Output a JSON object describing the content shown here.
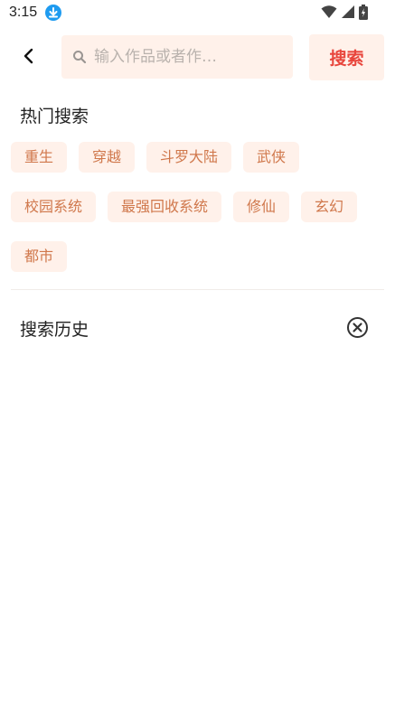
{
  "status_bar": {
    "time": "3:15",
    "icons": [
      "download-icon",
      "wifi-icon",
      "signal-icon",
      "battery-charging-icon"
    ]
  },
  "search": {
    "placeholder": "输入作品或者作…",
    "value": "",
    "button_label": "搜索"
  },
  "hot_search": {
    "title": "热门搜索",
    "tags": [
      "重生",
      "穿越",
      "斗罗大陆",
      "武侠",
      "校园系统",
      "最强回收系统",
      "修仙",
      "玄幻",
      "都市"
    ]
  },
  "history": {
    "title": "搜索历史",
    "items": []
  },
  "colors": {
    "accent": "#e8453c",
    "tag_text": "#d0784c",
    "tag_bg": "#fff1ea"
  }
}
